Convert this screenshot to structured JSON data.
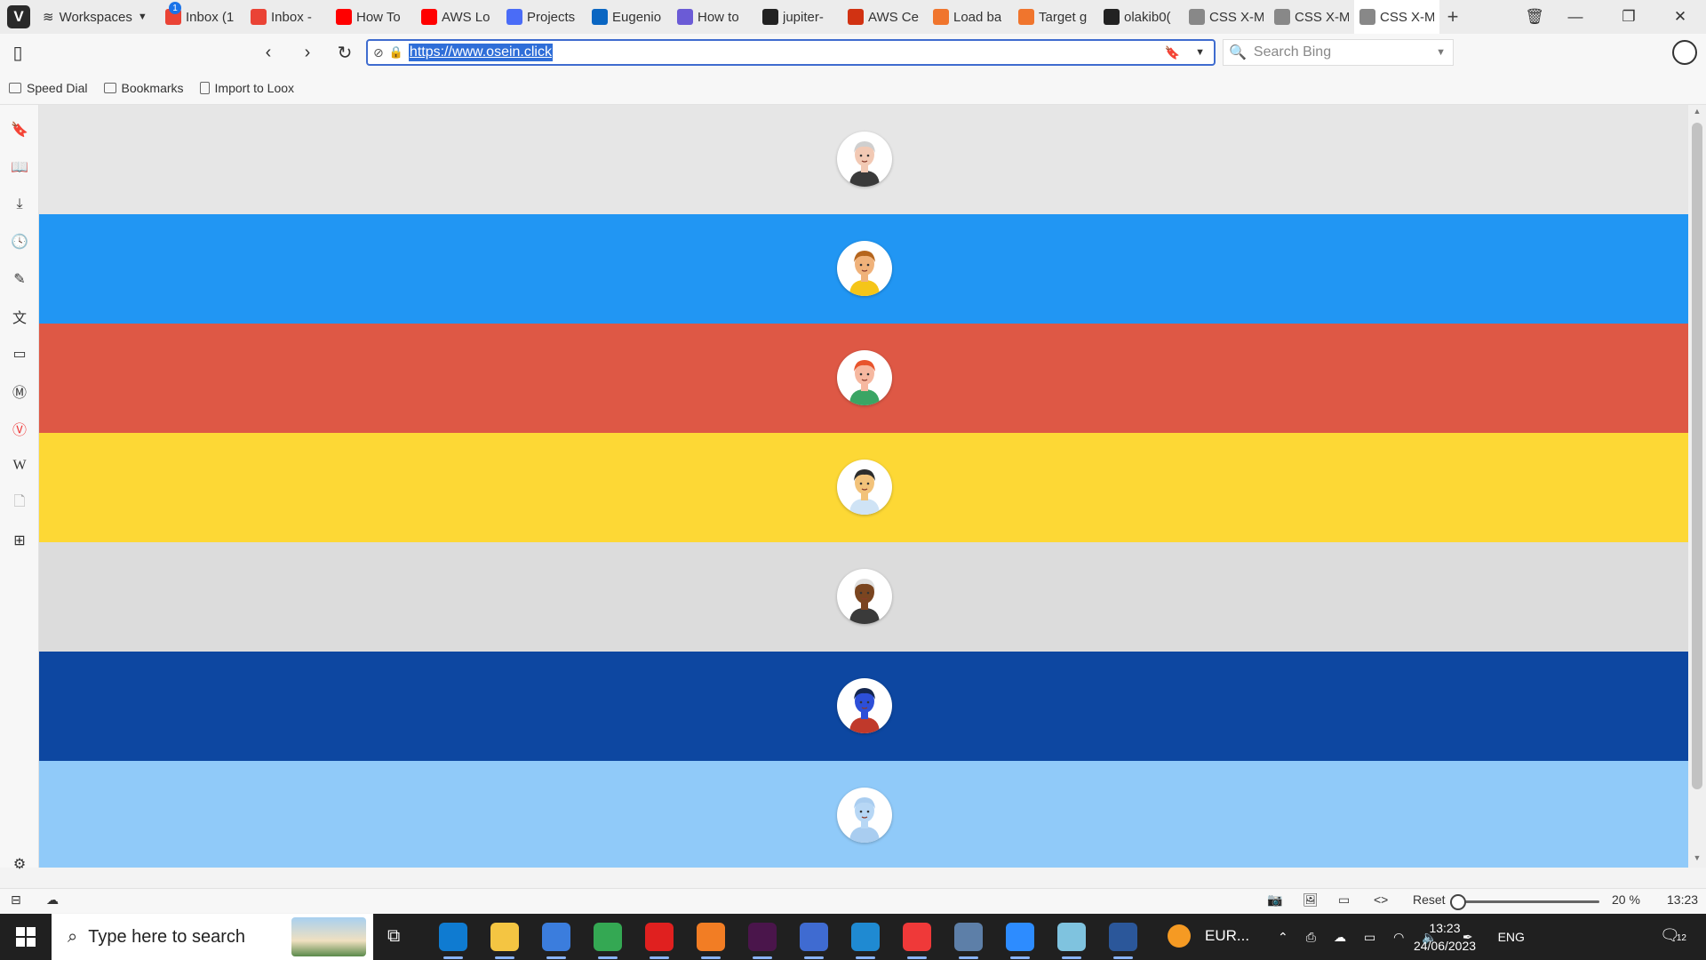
{
  "browser": {
    "workspaces_label": "Workspaces",
    "tabs": [
      {
        "title": "Inbox (1",
        "icon": "gmail-icon",
        "color": "#ea4335",
        "badge": "1"
      },
      {
        "title": "Inbox -",
        "icon": "gmail-icon",
        "color": "#ea4335"
      },
      {
        "title": "How To",
        "icon": "youtube-icon",
        "color": "#ff0000"
      },
      {
        "title": "AWS Lo",
        "icon": "youtube-icon",
        "color": "#ff0000"
      },
      {
        "title": "Projects",
        "icon": "projects-icon",
        "color": "#4a6cf7"
      },
      {
        "title": "Eugenio",
        "icon": "linkedin-icon",
        "color": "#0a66c2"
      },
      {
        "title": "How to",
        "icon": "cloud-icon",
        "color": "#6b5bd6"
      },
      {
        "title": "jupiter-",
        "icon": "github-icon",
        "color": "#222222"
      },
      {
        "title": "AWS Ce",
        "icon": "aws-icon",
        "color": "#d13212"
      },
      {
        "title": "Load ba",
        "icon": "orange-square-icon",
        "color": "#f0752d"
      },
      {
        "title": "Target g",
        "icon": "orange-square-icon",
        "color": "#f0752d"
      },
      {
        "title": "olakib0(",
        "icon": "github-icon",
        "color": "#222222"
      },
      {
        "title": "CSS X-M",
        "icon": "page-icon",
        "color": "#888888"
      },
      {
        "title": "CSS X-M",
        "icon": "page-icon",
        "color": "#888888"
      },
      {
        "title": "CSS X-M",
        "icon": "page-icon",
        "color": "#888888",
        "active": true
      }
    ],
    "url": "https://www.osein.click",
    "search_placeholder": "Search Bing",
    "bookmarks": [
      "Speed Dial",
      "Bookmarks",
      "Import to Loox"
    ],
    "status": {
      "reset_label": "Reset",
      "zoom_label": "20 %",
      "zoom_percent": 20,
      "time": "13:23"
    }
  },
  "page": {
    "bands": [
      {
        "color": "#e6e6e6",
        "skin": "#f2c9b4",
        "hair": "#cfcfcf",
        "shirt": "#3a3a3a"
      },
      {
        "color": "#2196f3",
        "skin": "#f0b27a",
        "hair": "#b5651d",
        "shirt": "#f5c518"
      },
      {
        "color": "#de5845",
        "skin": "#f6b8a0",
        "hair": "#e8542c",
        "shirt": "#3aa564"
      },
      {
        "color": "#fdd835",
        "skin": "#f2c27a",
        "hair": "#2c2c2c",
        "shirt": "#cfe3f5"
      },
      {
        "color": "#dcdcdc",
        "skin": "#7a4520",
        "hair": "#e0e0e0",
        "shirt": "#3a3a3a"
      },
      {
        "color": "#0d47a1",
        "skin": "#2d4fd8",
        "hair": "#14264f",
        "shirt": "#c0392b"
      },
      {
        "color": "#90caf9",
        "skin": "#b7d7f5",
        "hair": "#a9cdf0",
        "shirt": "#a9cdf0"
      }
    ]
  },
  "taskbar": {
    "search_placeholder": "Type here to search",
    "weather_label": "EUR...",
    "language": "ENG",
    "time": "13:23",
    "date": "24/06/2023",
    "notifications": "12",
    "apps": [
      {
        "name": "edge-icon",
        "color": "#0f7bd1"
      },
      {
        "name": "file-explorer-icon",
        "color": "#f4c542"
      },
      {
        "name": "store-icon",
        "color": "#3b7ddd"
      },
      {
        "name": "chrome-icon",
        "color": "#34a853"
      },
      {
        "name": "opera-icon",
        "color": "#e0201f"
      },
      {
        "name": "firefox-icon",
        "color": "#f27d24"
      },
      {
        "name": "slack-icon",
        "color": "#4a154b"
      },
      {
        "name": "network-icon",
        "color": "#3f6bd1"
      },
      {
        "name": "vscode-icon",
        "color": "#1f8ad2"
      },
      {
        "name": "vivaldi-icon",
        "color": "#ef3939"
      },
      {
        "name": "safari-icon",
        "color": "#5d7fa8"
      },
      {
        "name": "zoom-icon",
        "color": "#2d8cff"
      },
      {
        "name": "notepad-icon",
        "color": "#7fc3df"
      },
      {
        "name": "word-icon",
        "color": "#2b579a"
      }
    ]
  }
}
